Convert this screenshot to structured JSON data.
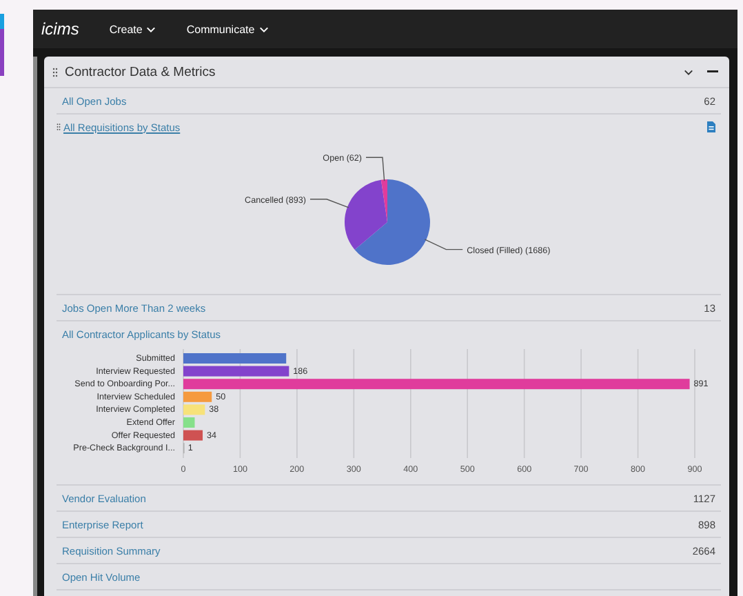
{
  "header": {
    "logo": "icims",
    "menus": [
      {
        "label": "Create"
      },
      {
        "label": "Communicate"
      }
    ]
  },
  "panel": {
    "title": "Contractor Data & Metrics",
    "items": [
      {
        "kind": "metric",
        "label": "All Open Jobs",
        "count": "62"
      },
      {
        "kind": "pie",
        "label": "All Requisitions by Status",
        "chart_data": {
          "type": "pie",
          "categories": [
            "Closed (Filled) (1686)",
            "Cancelled (893)",
            "Open (62)"
          ],
          "values": [
            1686,
            893,
            62
          ],
          "colors": [
            "#4f73c9",
            "#8343cc",
            "#e03c9c"
          ]
        }
      },
      {
        "kind": "metric",
        "label": "Jobs Open More Than 2 weeks",
        "count": "13"
      },
      {
        "kind": "bar",
        "label": "All Contractor Applicants by Status",
        "chart_data": {
          "type": "bar",
          "orientation": "horizontal",
          "grid": true,
          "categories": [
            "Submitted",
            "Interview Requested",
            "Send to Onboarding Por...",
            "Interview Scheduled",
            "Interview Completed",
            "Extend Offer",
            "Offer Requested",
            "Pre-Check Background I..."
          ],
          "values": [
            181,
            186,
            891,
            50,
            38,
            20,
            34,
            1
          ],
          "value_labels": [
            null,
            "186",
            "891",
            "50",
            "38",
            null,
            "34",
            "1"
          ],
          "colors": [
            "#4f73c9",
            "#8343cc",
            "#e03c9c",
            "#f59a3e",
            "#f7e27a",
            "#86e08a",
            "#cf5252",
            "#b0b0b0"
          ],
          "xlim": [
            0,
            900
          ],
          "xticks": [
            0,
            100,
            200,
            300,
            400,
            500,
            600,
            700,
            800,
            900
          ]
        }
      },
      {
        "kind": "metric",
        "label": "Vendor Evaluation",
        "count": "1127"
      },
      {
        "kind": "metric",
        "label": "Enterprise Report",
        "count": "898"
      },
      {
        "kind": "metric",
        "label": "Requisition Summary",
        "count": "2664"
      },
      {
        "kind": "metric",
        "label": "Open Hit Volume"
      }
    ]
  }
}
